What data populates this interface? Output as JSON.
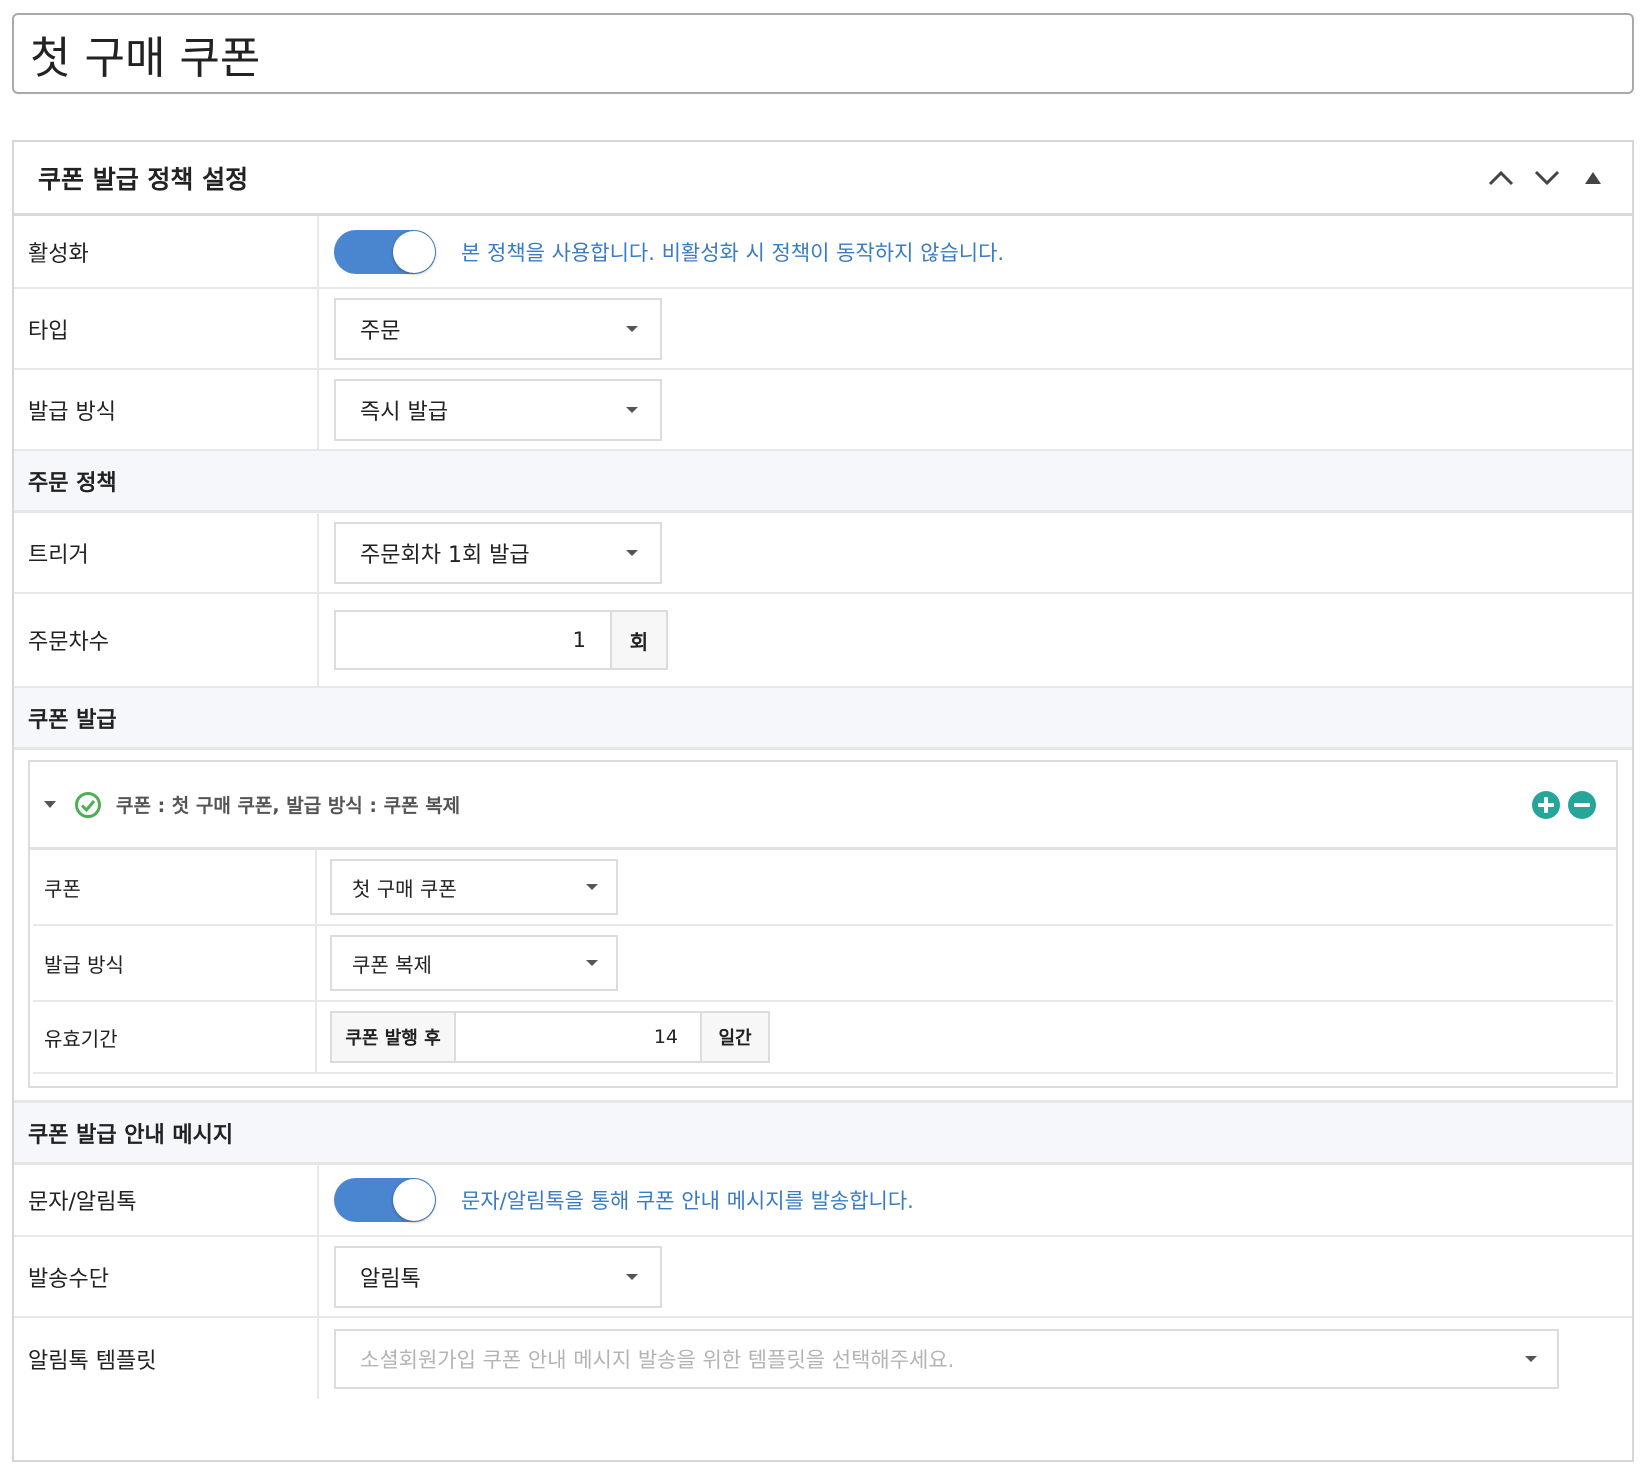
{
  "title": "첫 구매 쿠폰",
  "panel": {
    "title": "쿠폰 발급 정책 설정"
  },
  "activation": {
    "label": "활성화",
    "enabled": true,
    "help": "본 정책을 사용합니다. 비활성화 시 정책이 동작하지 않습니다."
  },
  "type": {
    "label": "타입",
    "value": "주문"
  },
  "issue_method": {
    "label": "발급 방식",
    "value": "즉시 발급"
  },
  "order_policy": {
    "section": "주문 정책",
    "trigger_label": "트리거",
    "trigger_value": "주문회차 1회 발급",
    "count_label": "주문차수",
    "count_value": "1",
    "count_unit": "회"
  },
  "coupon_issue": {
    "section": "쿠폰 발급",
    "summary": "쿠폰 : 첫 구매 쿠폰, 발급 방식 : 쿠폰 복제",
    "coupon_label": "쿠폰",
    "coupon_value": "첫 구매 쿠폰",
    "method_label": "발급 방식",
    "method_value": "쿠폰 복제",
    "validity_label": "유효기간",
    "validity_prefix": "쿠폰 발행 후",
    "validity_value": "14",
    "validity_unit": "일간"
  },
  "message": {
    "section": "쿠폰 발급 안내 메시지",
    "sms_label": "문자/알림톡",
    "sms_enabled": true,
    "sms_help": "문자/알림톡을 통해 쿠폰 안내 메시지를 발송합니다.",
    "channel_label": "발송수단",
    "channel_value": "알림톡",
    "template_label": "알림톡 템플릿",
    "template_placeholder": "소셜회원가입 쿠폰 안내 메시지 발송을 위한 템플릿을 선택해주세요."
  },
  "colors": {
    "accent": "#4a86d0",
    "help_text": "#3a7cc4",
    "success": "#4caf50",
    "teal": "#26a69a"
  },
  "icons": [
    "chevron-up-icon",
    "chevron-down-icon",
    "collapse-triangle-icon",
    "expand-caret-icon",
    "check-circle-icon",
    "plus-circle-icon",
    "minus-circle-icon",
    "dropdown-caret-icon"
  ]
}
